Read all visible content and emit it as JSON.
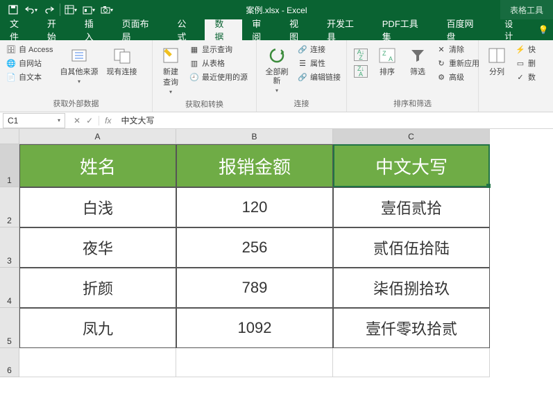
{
  "title": "案例.xlsx - Excel",
  "toolTab": "表格工具",
  "menu": {
    "file": "文件",
    "home": "开始",
    "insert": "插入",
    "layout": "页面布局",
    "formula": "公式",
    "data": "数据",
    "review": "审阅",
    "view": "视图",
    "dev": "开发工具",
    "pdf": "PDF工具集",
    "baidu": "百度网盘",
    "design": "设计"
  },
  "ribbon": {
    "g1": {
      "access": "自 Access",
      "web": "自网站",
      "text": "自文本",
      "other": "自其他来源",
      "conn": "现有连接",
      "label": "获取外部数据"
    },
    "g2": {
      "new": "新建",
      "newLine": "查询",
      "show": "显示查询",
      "table": "从表格",
      "recent": "最近使用的源",
      "label": "获取和转换"
    },
    "g3": {
      "refresh": "全部刷新",
      "conn": "连接",
      "prop": "属性",
      "edit": "编辑链接",
      "label": "连接"
    },
    "g4": {
      "sort": "排序",
      "filter": "筛选",
      "clear": "清除",
      "reapply": "重新应用",
      "adv": "高级",
      "label": "排序和筛选"
    },
    "g5": {
      "split": "分列",
      "flash": "快",
      "dup": "删",
      "val": "数"
    }
  },
  "nameBox": "C1",
  "formulaValue": "中文大写",
  "cols": [
    "A",
    "B",
    "C"
  ],
  "rows": [
    "1",
    "2",
    "3",
    "4",
    "5",
    "6"
  ],
  "chart_data": {
    "type": "table",
    "headers": [
      "姓名",
      "报销金额",
      "中文大写"
    ],
    "rows": [
      [
        "白浅",
        "120",
        "壹佰贰拾"
      ],
      [
        "夜华",
        "256",
        "贰佰伍拾陆"
      ],
      [
        "折颜",
        "789",
        "柒佰捌拾玖"
      ],
      [
        "凤九",
        "1092",
        "壹仟零玖拾贰"
      ]
    ]
  }
}
